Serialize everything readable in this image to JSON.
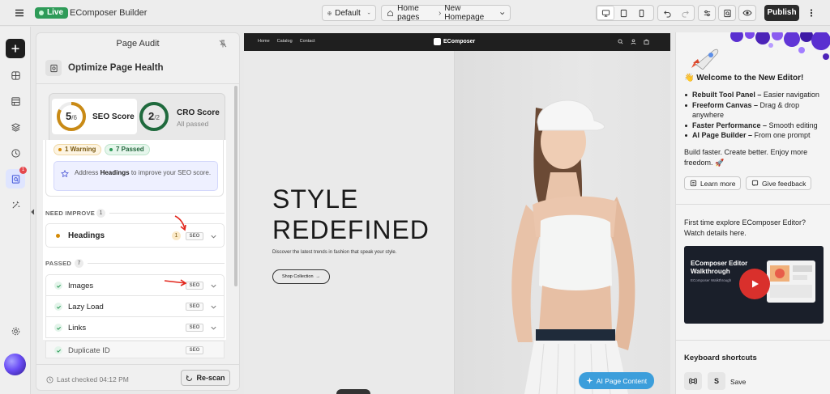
{
  "topbar": {
    "live": "Live",
    "app_title": "EComposer Builder",
    "theme_select": "Default",
    "page_breadcrumb": [
      "Home pages",
      "New Homepage"
    ],
    "publish": "Publish"
  },
  "panel": {
    "title": "Page Audit",
    "section_title": "Optimize Page Health",
    "seo_score": {
      "value": "5",
      "total": "/6",
      "fraction": 0.833,
      "label": "SEO Score",
      "color": "#c98a15"
    },
    "cro_score": {
      "value": "2",
      "total": "/2",
      "fraction": 1.0,
      "label": "CRO Score",
      "sub": "All passed",
      "color": "#1f6a3d"
    },
    "chips": {
      "warning": "1 Warning",
      "passed": "7 Passed"
    },
    "tip": {
      "prefix": "Address ",
      "bold": "Headings",
      "suffix": " to improve your SEO score."
    },
    "need_improve": {
      "label": "NEED IMPROVE",
      "count": "1"
    },
    "passed": {
      "label": "PASSED",
      "count": "7"
    },
    "improve_items": [
      {
        "label": "Headings",
        "count": "1",
        "tag": "SEO"
      }
    ],
    "passed_items": [
      {
        "label": "Images",
        "tag": "SEO"
      },
      {
        "label": "Lazy Load",
        "tag": "SEO"
      },
      {
        "label": "Links",
        "tag": "SEO"
      },
      {
        "label": "Duplicate ID",
        "tag": "SEO"
      }
    ],
    "last_checked": "Last checked 04:12 PM",
    "rescan": "Re-scan"
  },
  "canvas": {
    "nav_links": [
      "Home",
      "Catalog",
      "Contact"
    ],
    "logo": "EComposer",
    "headline": [
      "STYLE",
      "REDEFINED"
    ],
    "subtext": "Discover the latest trends in fashion that speak your style.",
    "cta": "Shop Collection",
    "ai_button": "AI Page Content"
  },
  "right": {
    "welcome": "Welcome to the New Editor!",
    "features": [
      {
        "bold": "Rebuilt Tool Panel –",
        "text": " Easier navigation"
      },
      {
        "bold": "Freeform Canvas –",
        "text": " Drag & drop anywhere"
      },
      {
        "bold": "Faster Performance –",
        "text": " Smooth editing"
      },
      {
        "bold": "AI Page Builder –",
        "text": " From one prompt"
      }
    ],
    "tagline": "Build faster. Create better. Enjoy more freedom. 🚀",
    "learn_more": "Learn more",
    "feedback": "Give feedback",
    "explore": "First time explore EComposer Editor? Watch details here.",
    "video_title": "EComposer Editor Walkthrough",
    "video_sub": "EComposer Walkthrough",
    "keyboard_title": "Keyboard shortcuts",
    "shortcut_key": "S",
    "shortcut_desc": "Save"
  }
}
